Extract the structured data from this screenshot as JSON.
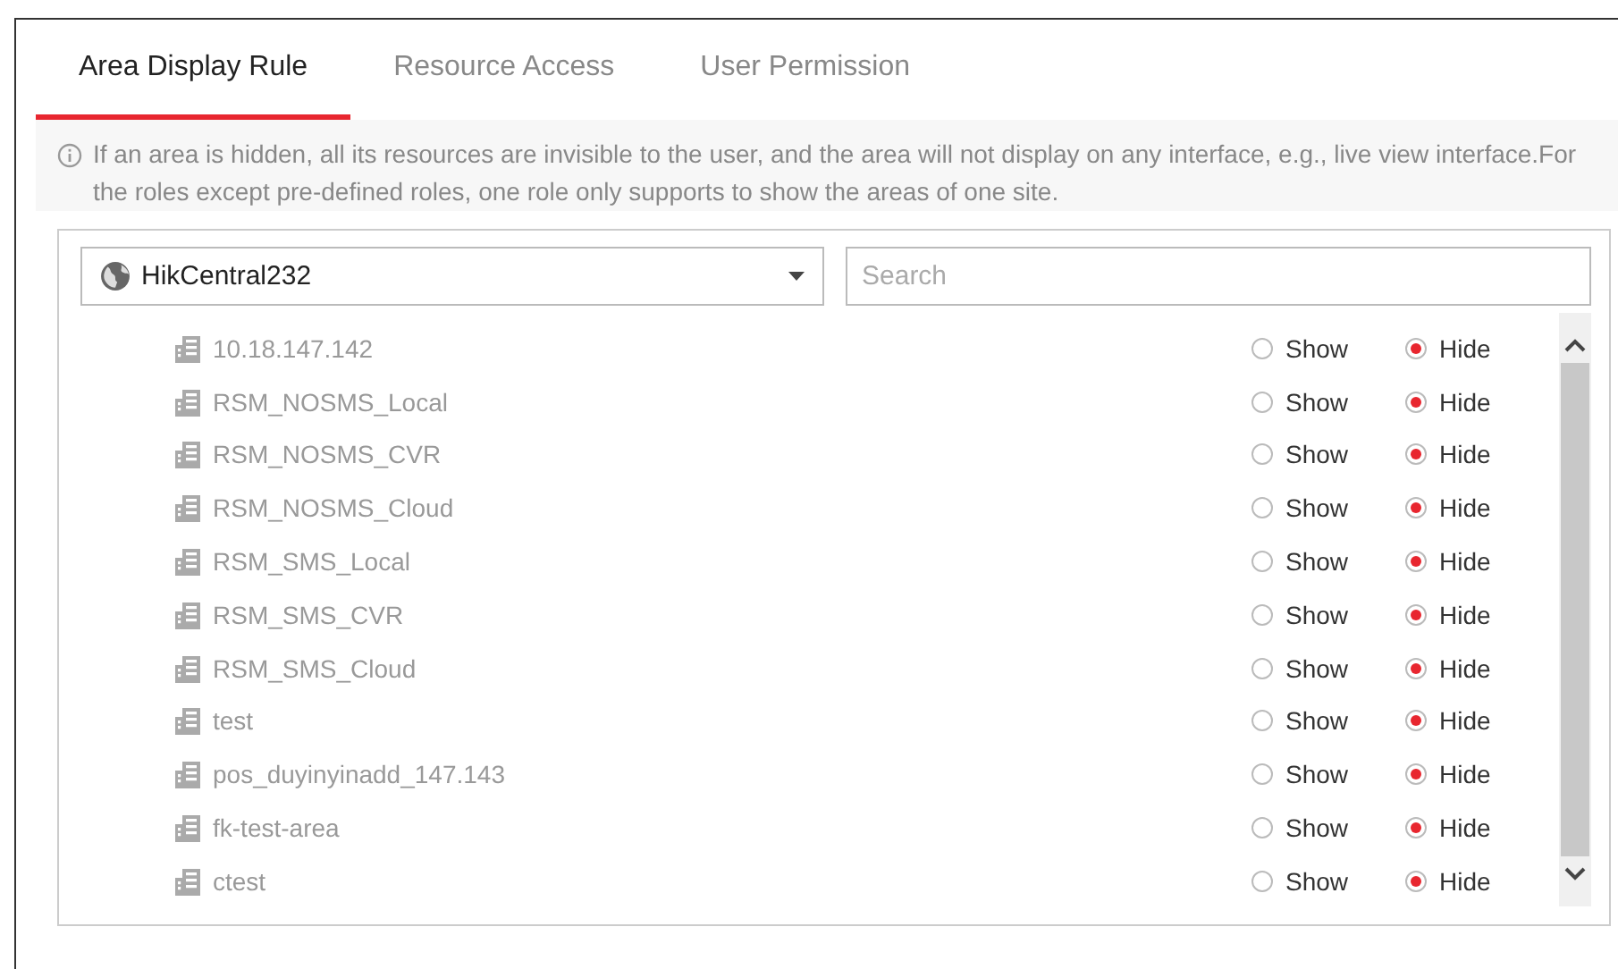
{
  "tabs": [
    {
      "label": "Area Display Rule",
      "selected": true
    },
    {
      "label": "Resource Access",
      "selected": false
    },
    {
      "label": "User Permission",
      "selected": false
    }
  ],
  "info": "If an area is hidden, all its resources are invisible to the user, and the area will not display on any interface, e.g., live view interface.For the roles except pre-defined roles, one role only supports to show the areas of one site.",
  "site_select": {
    "value": "HikCentral232"
  },
  "search": {
    "placeholder": "Search"
  },
  "areas": [
    {
      "name": "10.18.147.142",
      "options": [
        {
          "label": "Show",
          "selected": false
        },
        {
          "label": "Hide",
          "selected": true
        }
      ]
    },
    {
      "name": "RSM_NOSMS_Local",
      "options": [
        {
          "label": "Show",
          "selected": false
        },
        {
          "label": "Hide",
          "selected": true
        }
      ]
    },
    {
      "name": "RSM_NOSMS_CVR",
      "options": [
        {
          "label": "Show",
          "selected": false
        },
        {
          "label": "Hide",
          "selected": true
        }
      ]
    },
    {
      "name": "RSM_NOSMS_Cloud",
      "options": [
        {
          "label": "Show",
          "selected": false
        },
        {
          "label": "Hide",
          "selected": true
        }
      ]
    },
    {
      "name": "RSM_SMS_Local",
      "options": [
        {
          "label": "Show",
          "selected": false
        },
        {
          "label": "Hide",
          "selected": true
        }
      ]
    },
    {
      "name": "RSM_SMS_CVR",
      "options": [
        {
          "label": "Show",
          "selected": false
        },
        {
          "label": "Hide",
          "selected": true
        }
      ]
    },
    {
      "name": "RSM_SMS_Cloud",
      "options": [
        {
          "label": "Show",
          "selected": false
        },
        {
          "label": "Hide",
          "selected": true
        }
      ]
    },
    {
      "name": "test",
      "options": [
        {
          "label": "Show",
          "selected": false
        },
        {
          "label": "Hide",
          "selected": true
        }
      ]
    },
    {
      "name": "pos_duyinyinadd_147.143",
      "options": [
        {
          "label": "Show",
          "selected": false
        },
        {
          "label": "Hide",
          "selected": true
        }
      ]
    },
    {
      "name": "fk-test-area",
      "options": [
        {
          "label": "Show",
          "selected": false
        },
        {
          "label": "Hide",
          "selected": true
        }
      ]
    },
    {
      "name": "ctest",
      "options": [
        {
          "label": "Show",
          "selected": false
        },
        {
          "label": "Hide",
          "selected": true
        }
      ]
    }
  ]
}
